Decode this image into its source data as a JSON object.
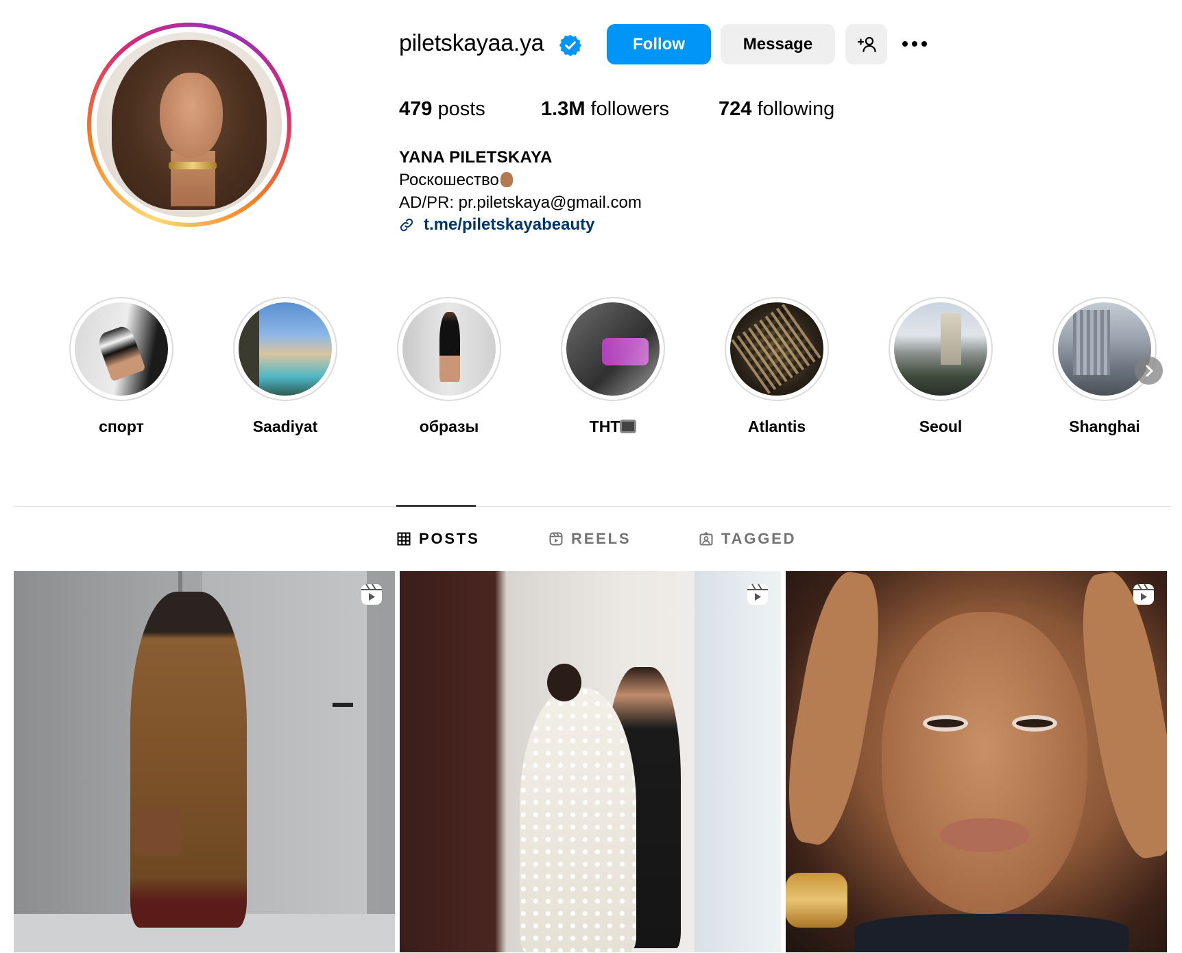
{
  "profile": {
    "username": "piletskayaa.ya",
    "verified": true,
    "buttons": {
      "follow": "Follow",
      "message": "Message"
    },
    "icons": {
      "verified": "verified-badge-icon",
      "add_user": "add-user-icon",
      "more": "more-options-icon"
    },
    "stats": {
      "posts_count": "479",
      "posts_label": "posts",
      "followers_count": "1.3M",
      "followers_label": "followers",
      "following_count": "724",
      "following_label": "following"
    },
    "full_name": "YANA PILETSKAYA",
    "bio": {
      "line1": "Роскошество",
      "line1_emoji": "hand-emoji",
      "line2": "AD/PR: pr.piletskaya@gmail.com",
      "link": "t.me/piletskayabeauty"
    }
  },
  "highlights": [
    {
      "label": "спорт"
    },
    {
      "label": "Saadiyat"
    },
    {
      "label": "образы"
    },
    {
      "label": "ТНТ",
      "emoji": "tv-emoji"
    },
    {
      "label": "Atlantis"
    },
    {
      "label": "Seoul"
    },
    {
      "label": "Shanghai"
    }
  ],
  "tabs": [
    {
      "label": "POSTS",
      "active": true,
      "icon": "grid-icon"
    },
    {
      "label": "REELS",
      "active": false,
      "icon": "reels-icon"
    },
    {
      "label": "TAGGED",
      "active": false,
      "icon": "tagged-icon"
    }
  ],
  "posts": [
    {
      "type": "reel",
      "icon": "reel-icon"
    },
    {
      "type": "reel",
      "icon": "reel-icon"
    },
    {
      "type": "reel",
      "icon": "reel-icon"
    }
  ],
  "colors": {
    "accent": "#0095f6",
    "link": "#00376b",
    "button_secondary": "#efefef",
    "muted_text": "#737373",
    "divider": "#dbdbdb"
  }
}
